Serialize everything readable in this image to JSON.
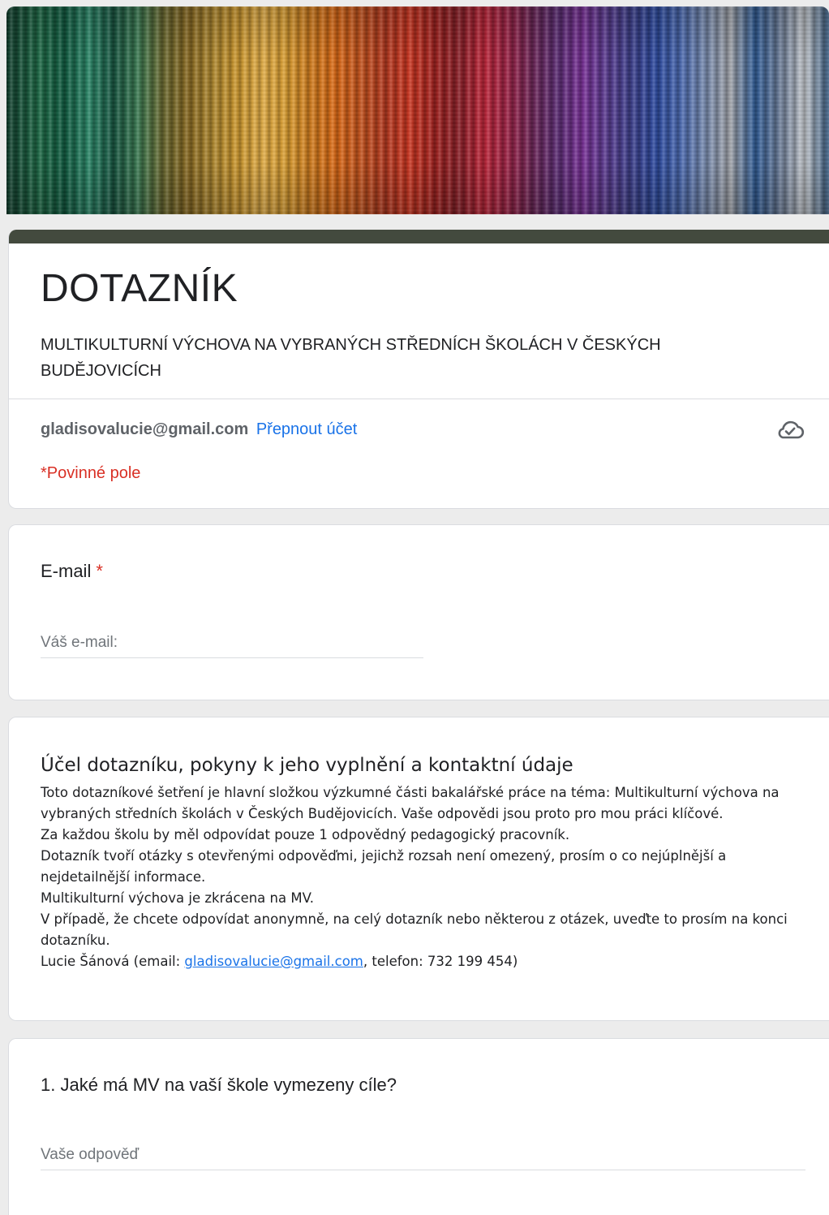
{
  "form": {
    "title": "DOTAZNÍK",
    "subtitle": "MULTIKULTURNÍ VÝCHOVA NA VYBRANÝCH STŘEDNÍCH ŠKOLÁCH V ČESKÝCH BUDĚJOVICÍCH",
    "account_email": "gladisovalucie@gmail.com",
    "switch_account_label": "Přepnout účet",
    "cloud_icon": "cloud-check-icon",
    "required_note": "*Povinné pole"
  },
  "email_question": {
    "label": "E-mail",
    "required_marker": "*",
    "placeholder": "Váš e-mail:"
  },
  "info_section": {
    "title": "Účel dotazníku, pokyny k jeho vyplnění a kontaktní údaje",
    "paragraphs": [
      "Toto dotazníkové šetření je hlavní složkou výzkumné části bakalářské práce na téma: Multikulturní výchova na vybraných středních školách v Českých Budějovicích. Vaše odpovědi jsou proto pro mou práci klíčové.",
      "Za každou školu by měl odpovídat pouze 1 odpovědný pedagogický pracovník.",
      "Dotazník tvoří otázky s otevřenými odpověďmi, jejichž rozsah není omezený, prosím o co nejúplnější a nejdetailnější informace.",
      "Multikulturní výchova je zkrácena na MV.",
      "V případě, že chcete odpovídat anonymně, na celý dotazník nebo některou z otázek, uveďte to prosím na konci dotazníku."
    ],
    "contact_prefix": "Lucie Šánová (email: ",
    "contact_email": "gladisovalucie@gmail.com",
    "contact_suffix": ", telefon: 732 199 454)"
  },
  "question_1": {
    "label": "1. Jaké má MV na vaší škole vymezeny cíle?",
    "placeholder": "Vaše odpověď"
  },
  "colors": {
    "accent_bar": "#434a3e",
    "link": "#1a73e8",
    "required": "#d93025"
  }
}
